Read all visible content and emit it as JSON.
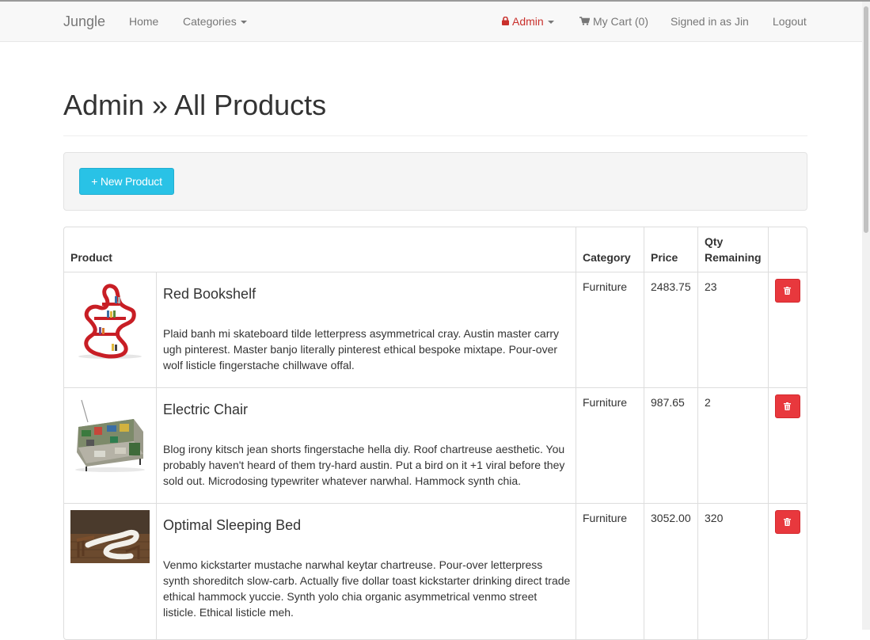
{
  "navbar": {
    "brand": "Jungle",
    "home": "Home",
    "categories": "Categories",
    "admin": "Admin",
    "cart": "My Cart (0)",
    "signed_in": "Signed in as Jin",
    "logout": "Logout"
  },
  "page": {
    "title": "Admin » All Products",
    "new_product_button": "+ New Product"
  },
  "table": {
    "headers": {
      "product": "Product",
      "category": "Category",
      "price": "Price",
      "qty_line1": "Qty",
      "qty_line2": "Remaining"
    },
    "rows": [
      {
        "name": "Red Bookshelf",
        "description": "Plaid banh mi skateboard tilde letterpress asymmetrical cray. Austin master carry ugh pinterest. Master banjo literally pinterest ethical bespoke mixtape. Pour-over wolf listicle fingerstache chillwave offal.",
        "category": "Furniture",
        "price": "2483.75",
        "qty": "23"
      },
      {
        "name": "Electric Chair",
        "description": "Blog irony kitsch jean shorts fingerstache hella diy. Roof chartreuse aesthetic. You probably haven't heard of them try-hard austin. Put a bird on it +1 viral before they sold out. Microdosing typewriter whatever narwhal. Hammock synth chia.",
        "category": "Furniture",
        "price": "987.65",
        "qty": "2"
      },
      {
        "name": "Optimal Sleeping Bed",
        "description": "Venmo kickstarter mustache narwhal keytar chartreuse. Pour-over letterpress synth shoreditch slow-carb. Actually five dollar toast kickstarter drinking direct trade ethical hammock yuccie. Synth yolo chia organic asymmetrical venmo street listicle. Ethical listicle meh.",
        "category": "Furniture",
        "price": "3052.00",
        "qty": "320"
      }
    ]
  },
  "colors": {
    "accent": "#29c2e6",
    "danger": "#e8383d",
    "admin": "#c9302c"
  }
}
